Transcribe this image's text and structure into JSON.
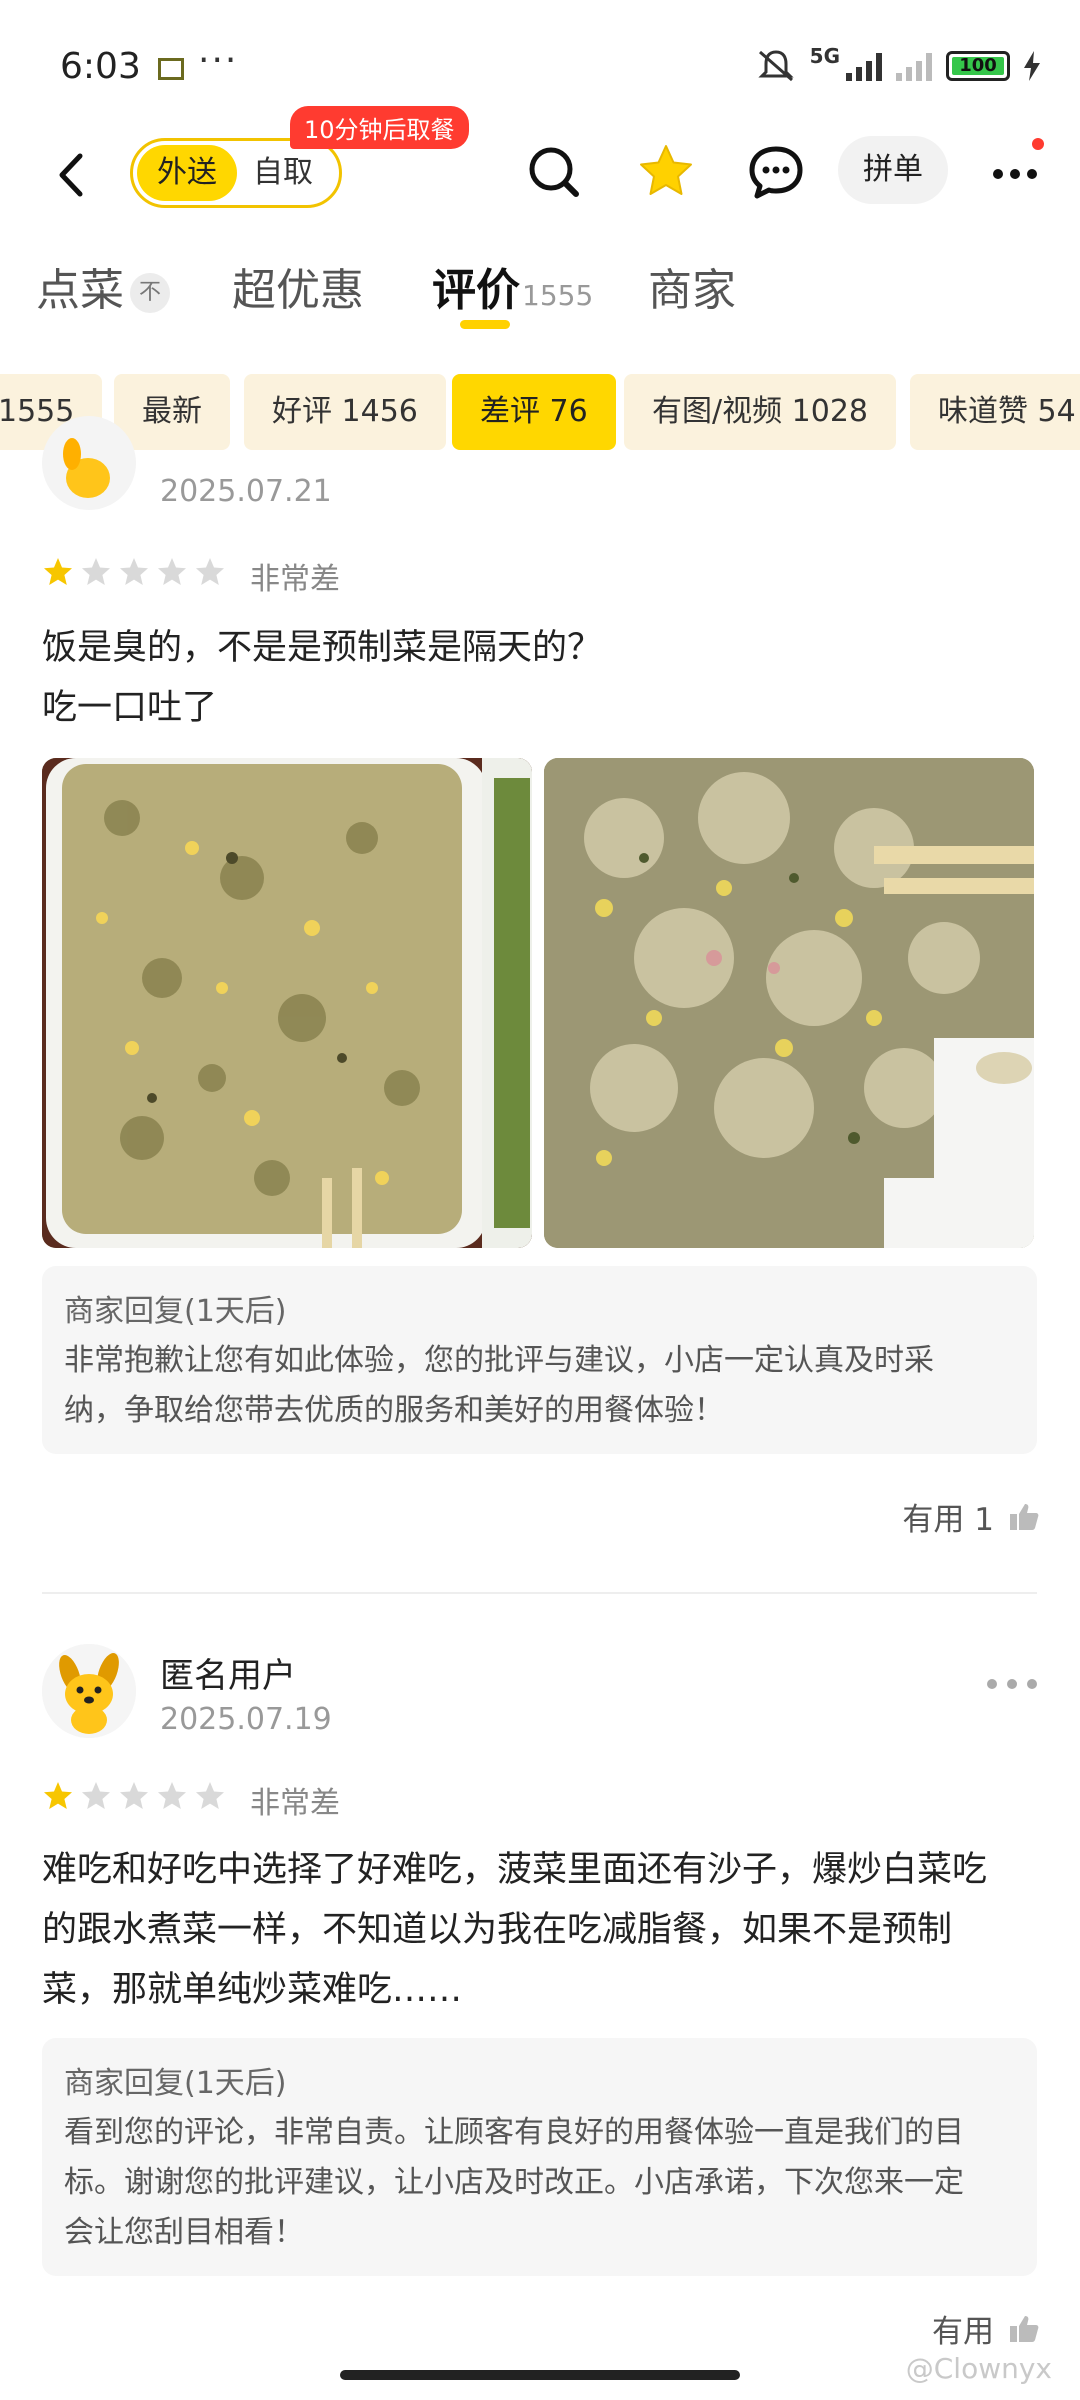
{
  "status": {
    "time": "6:03",
    "dots": "···",
    "network": "5G",
    "battery": "100"
  },
  "header": {
    "delivery": "外送",
    "pickup": "自取",
    "pickup_tip": "10分钟后取餐",
    "pindan": "拼单"
  },
  "tabs": [
    {
      "label": "点菜",
      "badge": "不"
    },
    {
      "label": "超优惠"
    },
    {
      "label": "评价",
      "count": "1555"
    },
    {
      "label": "商家"
    }
  ],
  "chips": [
    "1555",
    "最新",
    "好评 1456",
    "差评 76",
    "有图/视频 1028",
    "味道赞 54"
  ],
  "reviews": [
    {
      "date": "2025.07.21",
      "rating": 1,
      "rating_label": "非常差",
      "text_line1": "饭是臭的，不是是预制菜是隔天的？",
      "text_line2": "吃一口吐了",
      "reply_title": "商家回复(1天后)",
      "reply_line1": "非常抱歉让您有如此体验，您的批评与建议，小店一定认真及时采",
      "reply_line2": "纳，争取给您带去优质的服务和美好的用餐体验！",
      "useful": "有用 1"
    },
    {
      "user": "匿名用户",
      "date": "2025.07.19",
      "rating": 1,
      "rating_label": "非常差",
      "text_line1": "难吃和好吃中选择了好难吃，菠菜里面还有沙子，爆炒白菜吃",
      "text_line2": "的跟水煮菜一样，不知道以为我在吃减脂餐，如果不是预制",
      "text_line3": "菜，那就单纯炒菜难吃……",
      "reply_title": "商家回复(1天后)",
      "reply_line1": "看到您的评论，非常自责。让顾客有良好的用餐体验一直是我们的目",
      "reply_line2": "标。谢谢您的批评建议，让小店及时改正。小店承诺，下次您来一定",
      "reply_line3": "会让您刮目相看！",
      "useful": "有用"
    }
  ],
  "watermark": "@Clownyx",
  "colors": {
    "accent": "#ffd700",
    "star": "#f7c600",
    "star_empty": "#d9d9d9",
    "chip_bg": "#fbf2dd"
  }
}
